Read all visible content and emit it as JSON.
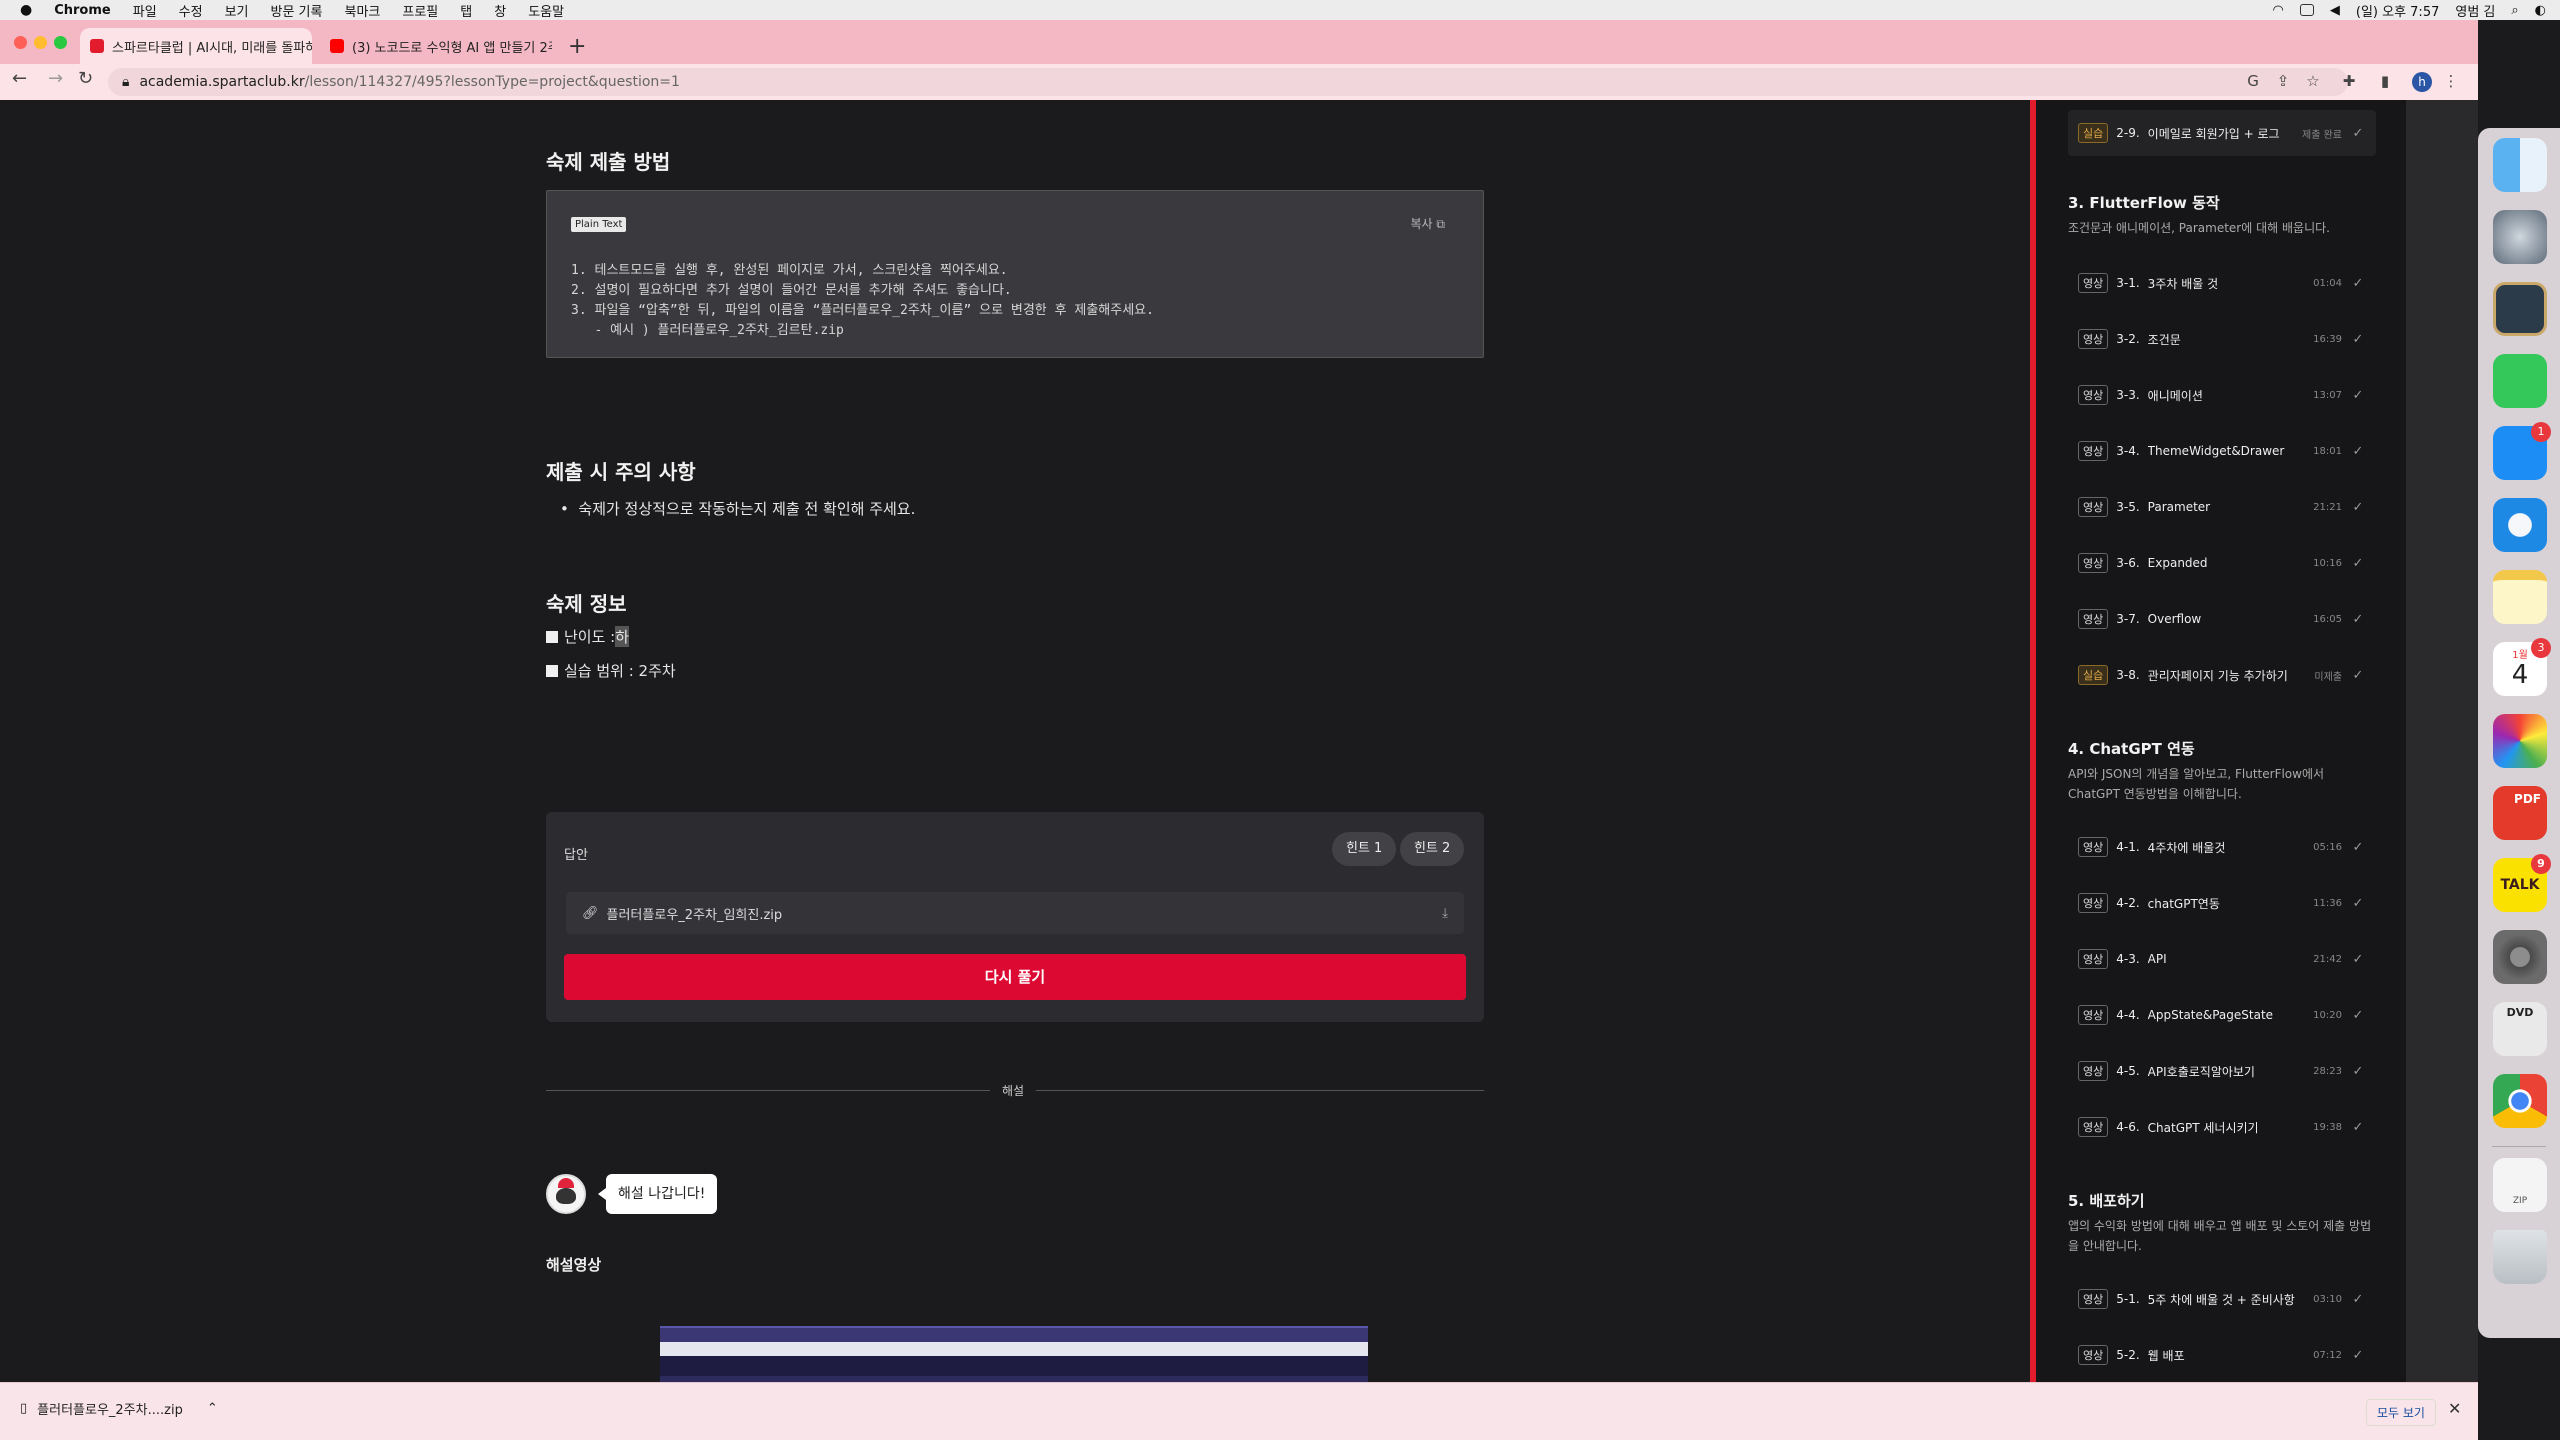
{
  "menubar": {
    "app": "Chrome",
    "items": [
      "파일",
      "수정",
      "보기",
      "방문 기록",
      "북마크",
      "프로필",
      "탭",
      "창",
      "도움말"
    ],
    "datetime": "(일) 오후 7:57",
    "user": "영범 김"
  },
  "tabs": [
    {
      "title": "스파르타클럽 | AI시대, 미래를 돌파하",
      "favicon_color": "#e21b2d"
    },
    {
      "title": "(3) 노코드로 수익형 AI 앱 만들기 2주",
      "favicon_color": "#ff0000"
    }
  ],
  "address": {
    "host": "academia.spartaclub.kr",
    "path": "/lesson/114327/495?lessonType=project&question=1"
  },
  "profile_initial": "h",
  "main": {
    "submit_heading": "숙제 제출 방법",
    "code_tag": "Plain Text",
    "copy_label": "복사",
    "code_lines": [
      "1. 테스트모드를 실행 후, 완성된 페이지로 가서, 스크린샷을 찍어주세요.",
      "2. 설명이 필요하다면 추가 설명이 들어간 문서를 추가해 주셔도 좋습니다.",
      "3. 파일을 “압축”한 뒤, 파일의 이름을 “플러터플로우_2주차_이름” 으로 변경한 후 제출해주세요.",
      "   - 예시 ) 플러터플로우_2주차_김르탄.zip"
    ],
    "caution_heading": "제출 시 주의 사항",
    "caution_bullet": "숙제가 정상적으로 작동하는지 제출 전 확인해 주세요.",
    "info_heading": "숙제 정보",
    "difficulty_label": "난이도 : ",
    "difficulty_value": "하",
    "range_label": "실습 범위 : 2주차",
    "answer_label": "답안",
    "hint1": "힌트 1",
    "hint2": "힌트 2",
    "file_name": "플러터플로우_2주차_임희진.zip",
    "retry_label": "다시 풀기",
    "divider_label": "해설",
    "bubble_text": "해설 나갑니다!",
    "video_heading": "해설영상"
  },
  "sidebar": {
    "top_lesson": {
      "badge": "실습",
      "num": "2-9.",
      "title": "이메일로 회원가입 + 로그",
      "status": "제출 완료"
    },
    "sections": [
      {
        "title": "3. FlutterFlow 동작",
        "desc": "조건문과 애니메이션, Parameter에 대해 배웁니다.",
        "lessons": [
          {
            "badge": "영상",
            "num": "3-1.",
            "title": "3주차 배울 것",
            "dur": "01:04"
          },
          {
            "badge": "영상",
            "num": "3-2.",
            "title": "조건문",
            "dur": "16:39"
          },
          {
            "badge": "영상",
            "num": "3-3.",
            "title": "애니메이션",
            "dur": "13:07"
          },
          {
            "badge": "영상",
            "num": "3-4.",
            "title": "ThemeWidget&Drawer",
            "dur": "18:01"
          },
          {
            "badge": "영상",
            "num": "3-5.",
            "title": "Parameter",
            "dur": "21:21"
          },
          {
            "badge": "영상",
            "num": "3-6.",
            "title": "Expanded",
            "dur": "10:16"
          },
          {
            "badge": "영상",
            "num": "3-7.",
            "title": "Overflow",
            "dur": "16:05"
          },
          {
            "badge": "실습",
            "num": "3-8.",
            "title": "관리자페이지 기능 추가하기",
            "dur": "미제출"
          }
        ]
      },
      {
        "title": "4. ChatGPT 연동",
        "desc": "API와 JSON의 개념을 알아보고, FlutterFlow에서 ChatGPT 연동방법을 이해합니다.",
        "lessons": [
          {
            "badge": "영상",
            "num": "4-1.",
            "title": "4주차에 배울것",
            "dur": "05:16"
          },
          {
            "badge": "영상",
            "num": "4-2.",
            "title": "chatGPT연동",
            "dur": "11:36"
          },
          {
            "badge": "영상",
            "num": "4-3.",
            "title": "API",
            "dur": "21:42"
          },
          {
            "badge": "영상",
            "num": "4-4.",
            "title": "AppState&PageState",
            "dur": "10:20"
          },
          {
            "badge": "영상",
            "num": "4-5.",
            "title": "API호출로직알아보기",
            "dur": "28:23"
          },
          {
            "badge": "영상",
            "num": "4-6.",
            "title": "ChatGPT 세너시키기",
            "dur": "19:38"
          }
        ]
      },
      {
        "title": "5. 배포하기",
        "desc": "앱의 수익화 방법에 대해 배우고 앱 배포 및 스토어 제출 방법을 안내합니다.",
        "lessons": [
          {
            "badge": "영상",
            "num": "5-1.",
            "title": "5주 차에 배울 것 + 준비사항",
            "dur": "03:10"
          },
          {
            "badge": "영상",
            "num": "5-2.",
            "title": "웹 배포",
            "dur": "07:12"
          }
        ]
      }
    ]
  },
  "dock": {
    "badges": {
      "appstore": "1",
      "calendar": "3",
      "kakaotalk": "9"
    },
    "calendar_month": "1월",
    "calendar_day": "4",
    "kakao_label": "TALK",
    "pdf_label": "PDF",
    "dvd_label": "DVD",
    "zip_label": "ZIP"
  },
  "downloads": {
    "file": "플러터플로우_2주차....zip",
    "show_all": "모두 보기"
  },
  "colors": {
    "accent": "#dc0a33",
    "sidebar_line": "#e21b2d",
    "chrome_tab": "#f4b8c4"
  }
}
